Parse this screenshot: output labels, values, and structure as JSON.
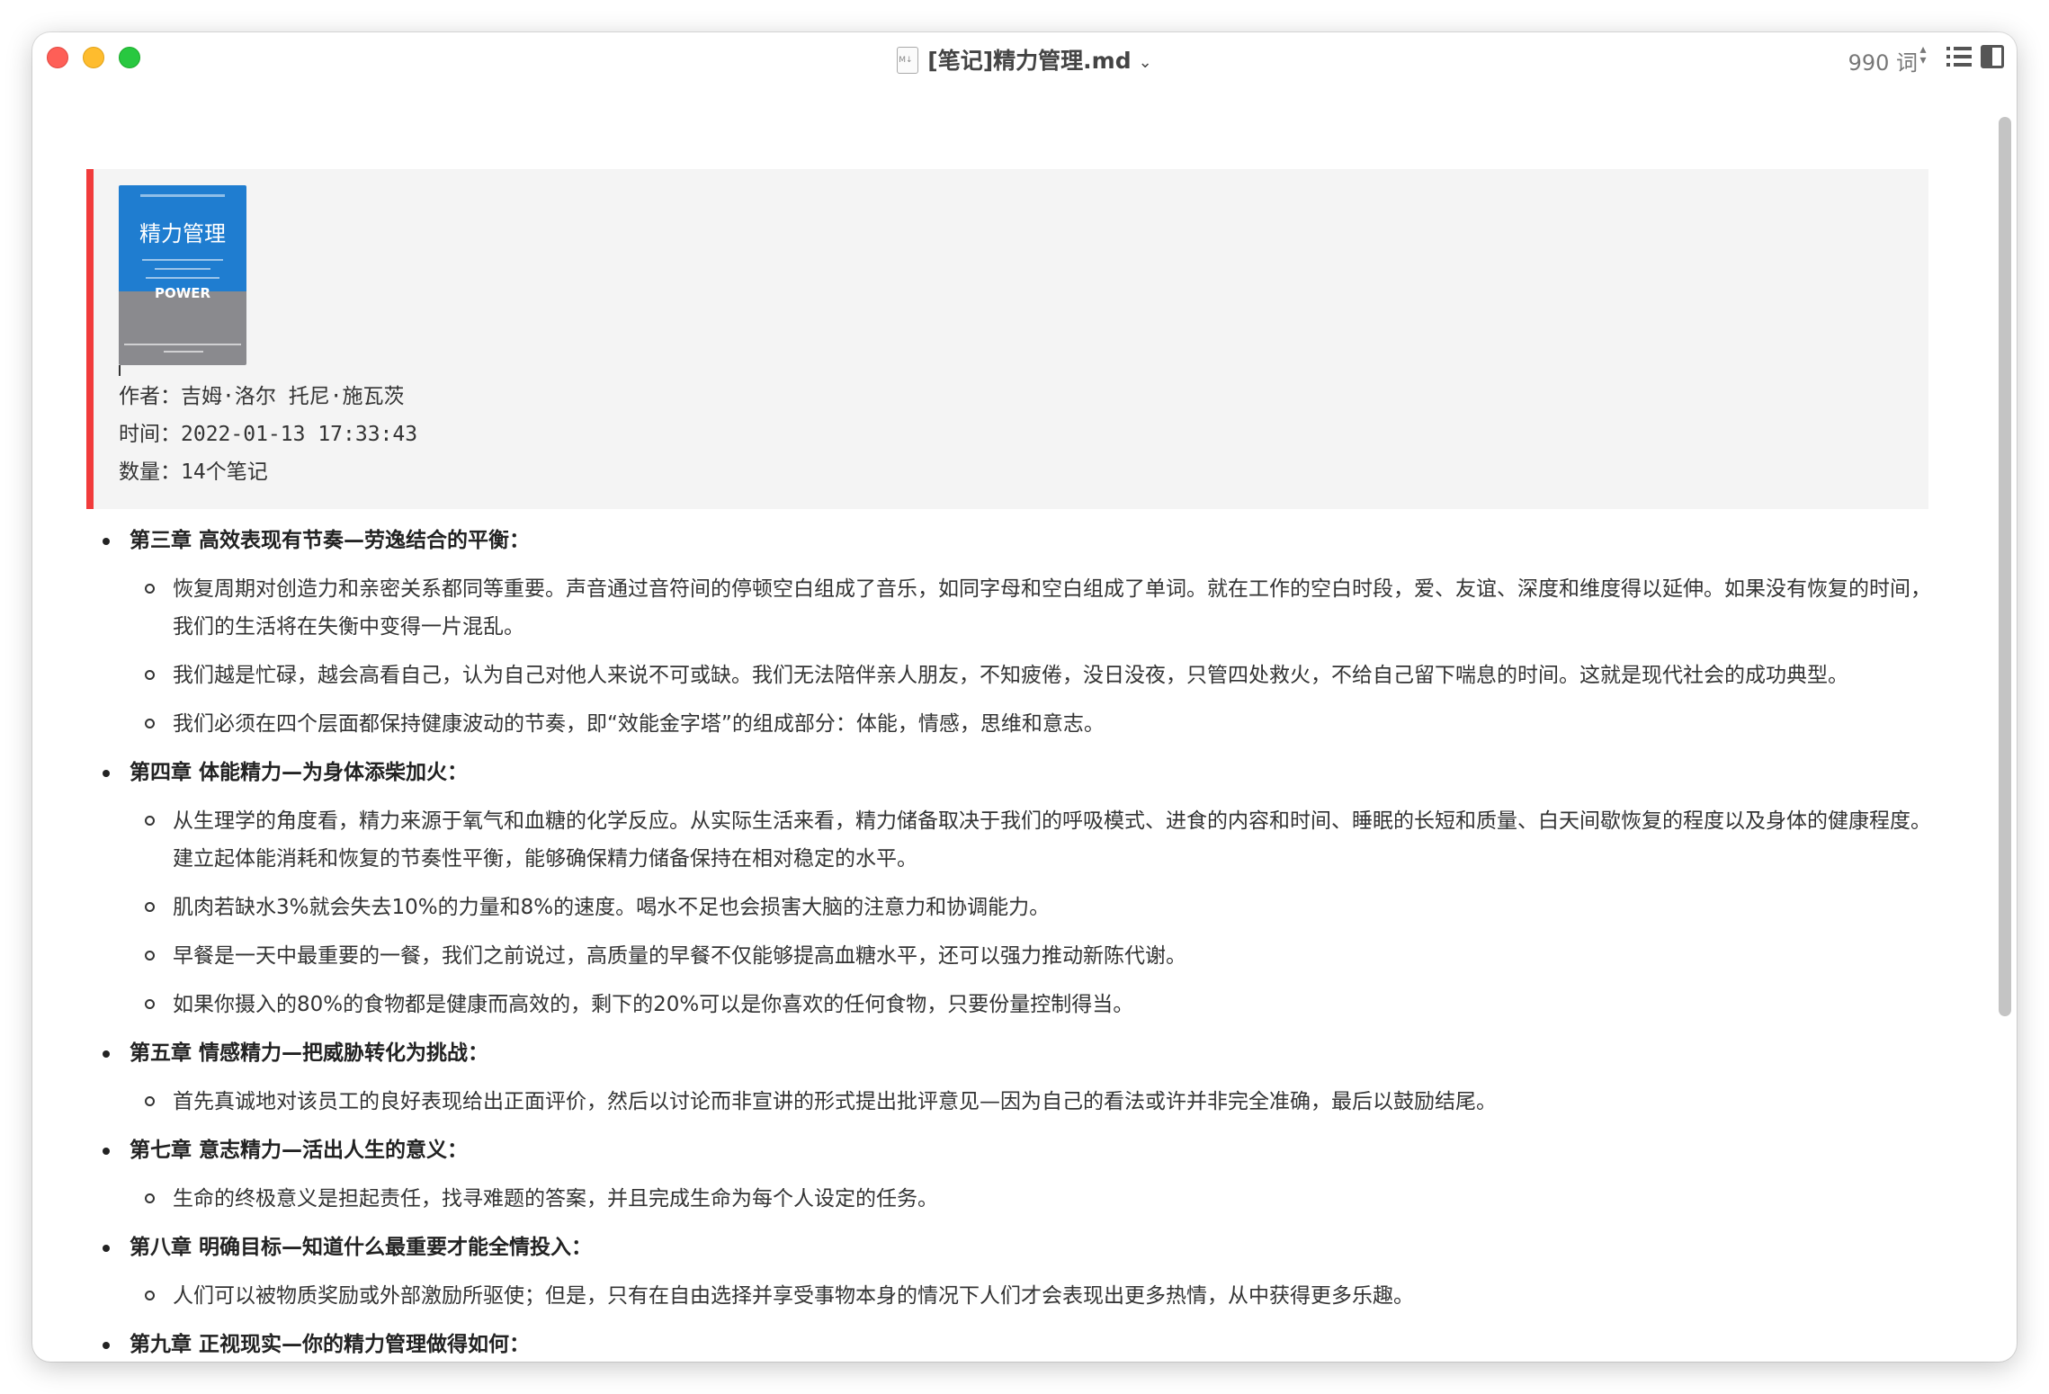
{
  "window": {
    "title": "[笔记]精力管理.md",
    "word_count": "990 词"
  },
  "book": {
    "cover_title": "精力管理",
    "cover_subtitle": "POWER",
    "author_line": "作者：吉姆·洛尔 托尼·施瓦茨",
    "time_line": "时间：2022-01-13 17:33:43",
    "count_line": "数量：14个笔记"
  },
  "chapters": [
    {
      "title": "第三章 高效表现有节奏—劳逸结合的平衡：",
      "notes": [
        "恢复周期对创造力和亲密关系都同等重要。声音通过音符间的停顿空白组成了音乐，如同字母和空白组成了单词。就在工作的空白时段，爱、友谊、深度和维度得以延伸。如果没有恢复的时间，我们的生活将在失衡中变得一片混乱。",
        "我们越是忙碌，越会高看自己，认为自己对他人来说不可或缺。我们无法陪伴亲人朋友，不知疲倦，没日没夜，只管四处救火，不给自己留下喘息的时间。这就是现代社会的成功典型。",
        "我们必须在四个层面都保持健康波动的节奏，即“效能金字塔”的组成部分：体能，情感，思维和意志。"
      ]
    },
    {
      "title": "第四章 体能精力—为身体添柴加火：",
      "notes": [
        "从生理学的角度看，精力来源于氧气和血糖的化学反应。从实际生活来看，精力储备取决于我们的呼吸模式、进食的内容和时间、睡眠的长短和质量、白天间歇恢复的程度以及身体的健康程度。建立起体能消耗和恢复的节奏性平衡，能够确保精力储备保持在相对稳定的水平。",
        "肌肉若缺水3%就会失去10%的力量和8%的速度。喝水不足也会损害大脑的注意力和协调能力。",
        "早餐是一天中最重要的一餐，我们之前说过，高质量的早餐不仅能够提高血糖水平，还可以强力推动新陈代谢。",
        "如果你摄入的80%的食物都是健康而高效的，剩下的20%可以是你喜欢的任何食物，只要份量控制得当。"
      ]
    },
    {
      "title": "第五章 情感精力—把威胁转化为挑战：",
      "notes": [
        "首先真诚地对该员工的良好表现给出正面评价，然后以讨论而非宣讲的形式提出批评意见—因为自己的看法或许并非完全准确，最后以鼓励结尾。"
      ]
    },
    {
      "title": "第七章 意志精力—活出人生的意义：",
      "notes": [
        "生命的终极意义是担起责任，找寻难题的答案，并且完成生命为每个人设定的任务。"
      ]
    },
    {
      "title": "第八章 明确目标—知道什么最重要才能全情投入：",
      "notes": [
        "人们可以被物质奖励或外部激励所驱使；但是，只有在自由选择并享受事物本身的情况下人们才会表现出更多热情，从中获得更多乐趣。"
      ]
    },
    {
      "title": "第九章 正视现实—你的精力管理做得如何：",
      "notes": []
    }
  ]
}
